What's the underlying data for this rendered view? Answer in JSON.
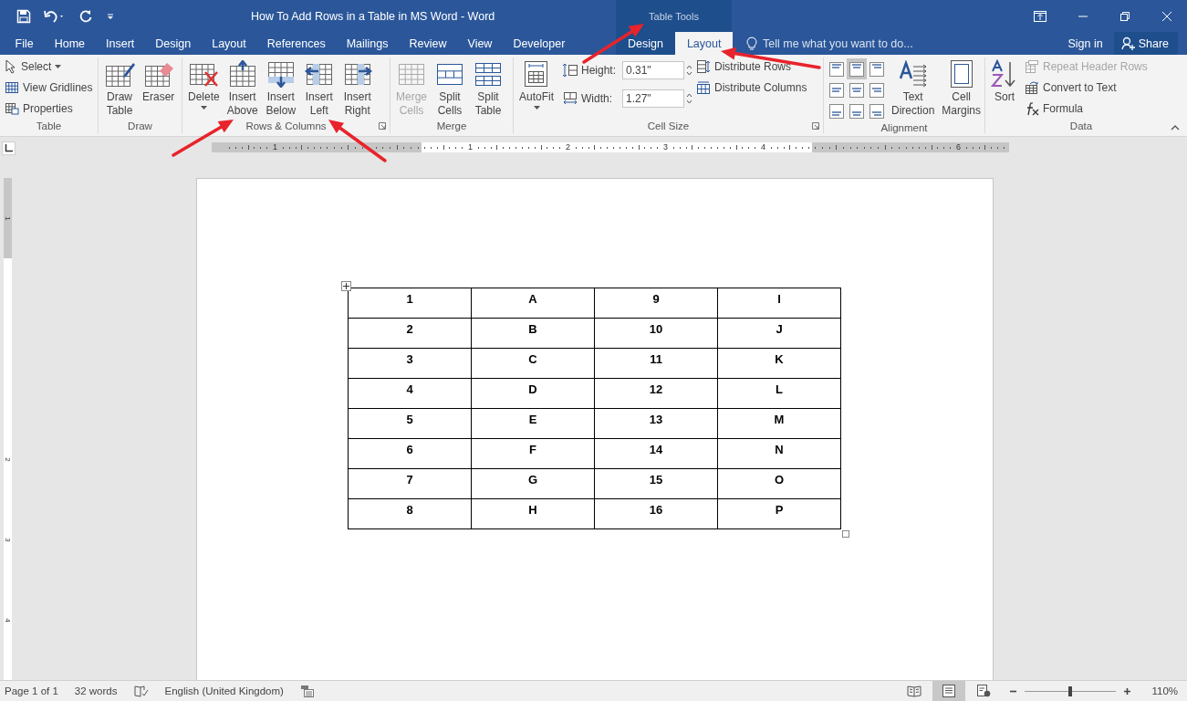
{
  "window": {
    "title": "How To Add Rows in a Table in MS Word - Word",
    "context_header": "Table Tools"
  },
  "tabs": [
    {
      "label": "File",
      "selected": false,
      "contextual": false
    },
    {
      "label": "Home",
      "selected": false,
      "contextual": false
    },
    {
      "label": "Insert",
      "selected": false,
      "contextual": false
    },
    {
      "label": "Design",
      "selected": false,
      "contextual": false
    },
    {
      "label": "Layout",
      "selected": false,
      "contextual": false
    },
    {
      "label": "References",
      "selected": false,
      "contextual": false
    },
    {
      "label": "Mailings",
      "selected": false,
      "contextual": false
    },
    {
      "label": "Review",
      "selected": false,
      "contextual": false
    },
    {
      "label": "View",
      "selected": false,
      "contextual": false
    },
    {
      "label": "Developer",
      "selected": false,
      "contextual": false
    },
    {
      "label": "Design",
      "selected": false,
      "contextual": true
    },
    {
      "label": "Layout",
      "selected": true,
      "contextual": true
    }
  ],
  "tell_me": {
    "placeholder": "Tell me what you want to do..."
  },
  "sign_in": "Sign in",
  "share": "Share",
  "ribbon_groups": [
    {
      "label": "Table",
      "launcher": false,
      "columns": [
        [
          {
            "kind": "small",
            "label": "Select",
            "dropdown": true,
            "disabled": false
          },
          {
            "kind": "small",
            "label": "View Gridlines",
            "dropdown": false,
            "disabled": false
          },
          {
            "kind": "small",
            "label": "Properties",
            "dropdown": false,
            "disabled": false
          }
        ]
      ]
    },
    {
      "label": "Draw",
      "launcher": false,
      "columns": [
        [
          {
            "kind": "large",
            "label": "Draw Table",
            "dropdown": false,
            "disabled": false
          }
        ],
        [
          {
            "kind": "large",
            "label": "Eraser",
            "dropdown": false,
            "disabled": false
          }
        ]
      ]
    },
    {
      "label": "Rows & Columns",
      "launcher": true,
      "columns": [
        [
          {
            "kind": "large",
            "label": "Delete",
            "dropdown": true,
            "disabled": false
          }
        ],
        [
          {
            "kind": "large",
            "label": "Insert Above",
            "dropdown": false,
            "disabled": false
          }
        ],
        [
          {
            "kind": "large",
            "label": "Insert Below",
            "dropdown": false,
            "disabled": false
          }
        ],
        [
          {
            "kind": "large",
            "label": "Insert Left",
            "dropdown": false,
            "disabled": false
          }
        ],
        [
          {
            "kind": "large",
            "label": "Insert Right",
            "dropdown": false,
            "disabled": false
          }
        ]
      ]
    },
    {
      "label": "Merge",
      "launcher": false,
      "columns": [
        [
          {
            "kind": "large",
            "label": "Merge Cells",
            "dropdown": false,
            "disabled": true
          }
        ],
        [
          {
            "kind": "large",
            "label": "Split Cells",
            "dropdown": false,
            "disabled": false
          }
        ],
        [
          {
            "kind": "large",
            "label": "Split Table",
            "dropdown": false,
            "disabled": false
          }
        ]
      ]
    },
    {
      "label": "Cell Size",
      "launcher": true,
      "columns": [
        [
          {
            "kind": "large",
            "label": "AutoFit",
            "dropdown": true,
            "disabled": false
          }
        ],
        [
          {
            "kind": "spin",
            "label": "Height:",
            "value": "0.31\""
          },
          {
            "kind": "spin",
            "label": "Width:",
            "value": "1.27\""
          }
        ],
        [
          {
            "kind": "small",
            "label": "Distribute Rows",
            "dropdown": false,
            "disabled": false
          },
          {
            "kind": "small",
            "label": "Distribute Columns",
            "dropdown": false,
            "disabled": false
          }
        ]
      ]
    },
    {
      "label": "Alignment",
      "launcher": false,
      "columns": [
        [
          {
            "kind": "align_grid",
            "cells": [
              {
                "selected": false
              },
              {
                "selected": true
              },
              {
                "selected": false
              },
              {
                "selected": false
              },
              {
                "selected": false
              },
              {
                "selected": false
              },
              {
                "selected": false
              },
              {
                "selected": false
              },
              {
                "selected": false
              }
            ]
          }
        ],
        [
          {
            "kind": "large",
            "label": "Text Direction",
            "dropdown": false,
            "disabled": false
          }
        ],
        [
          {
            "kind": "large",
            "label": "Cell Margins",
            "dropdown": false,
            "disabled": false
          }
        ]
      ]
    },
    {
      "label": "Data",
      "launcher": false,
      "columns": [
        [
          {
            "kind": "large",
            "label": "Sort",
            "dropdown": false,
            "disabled": false
          }
        ],
        [
          {
            "kind": "small",
            "label": "Repeat Header Rows",
            "dropdown": false,
            "disabled": true
          },
          {
            "kind": "small",
            "label": "Convert to Text",
            "dropdown": false,
            "disabled": false
          },
          {
            "kind": "small",
            "label": "Formula",
            "dropdown": false,
            "disabled": false
          }
        ]
      ]
    }
  ],
  "ruler": {
    "slots": [
      {
        "label": "1",
        "margin": true
      },
      {
        "margin": true
      },
      {
        "label": "1",
        "margin": false
      },
      {
        "label": "2",
        "margin": false
      },
      {
        "label": "3",
        "margin": false
      },
      {
        "label": "4",
        "margin": false
      },
      {
        "margin": true
      },
      {
        "label": "6",
        "margin": true
      }
    ]
  },
  "vertical_ruler": {
    "slots": [
      {
        "label": "1",
        "margin": true
      },
      {
        "margin": false
      },
      {
        "margin": false
      },
      {
        "label": "2",
        "margin": false
      },
      {
        "label": "3",
        "margin": false
      },
      {
        "label": "4",
        "margin": false
      }
    ]
  },
  "table": {
    "rows": [
      [
        "1",
        "A",
        "9",
        "I"
      ],
      [
        "2",
        "B",
        "10",
        "J"
      ],
      [
        "3",
        "C",
        "11",
        "K"
      ],
      [
        "4",
        "D",
        "12",
        "L"
      ],
      [
        "5",
        "E",
        "13",
        "M"
      ],
      [
        "6",
        "F",
        "14",
        "N"
      ],
      [
        "7",
        "G",
        "15",
        "O"
      ],
      [
        "8",
        "H",
        "16",
        "P"
      ]
    ]
  },
  "status_bar": {
    "page": "Page 1 of 1",
    "words": "32 words",
    "language": "English (United Kingdom)",
    "views": [
      {
        "selected": false
      },
      {
        "selected": true
      },
      {
        "selected": false
      }
    ],
    "zoom": {
      "level": 0.5,
      "reading": "110%"
    }
  }
}
